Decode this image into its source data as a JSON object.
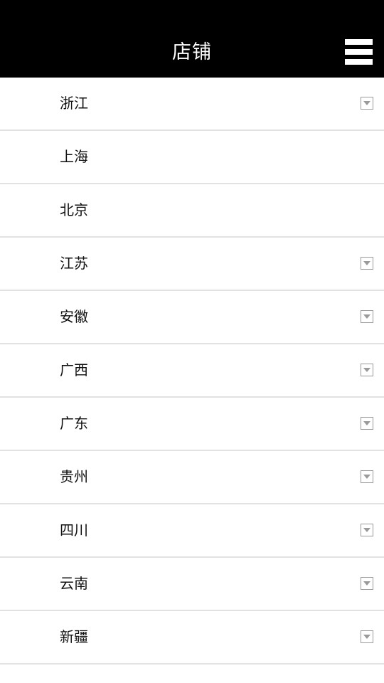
{
  "header": {
    "title": "店铺",
    "menu_icon": "hamburger-menu-icon",
    "background": "#000000",
    "text_color": "#ffffff"
  },
  "regions": [
    {
      "label": "浙江",
      "expandable": true
    },
    {
      "label": "上海",
      "expandable": false
    },
    {
      "label": "北京",
      "expandable": false
    },
    {
      "label": "江苏",
      "expandable": true
    },
    {
      "label": "安徽",
      "expandable": true
    },
    {
      "label": "广西",
      "expandable": true
    },
    {
      "label": "广东",
      "expandable": true
    },
    {
      "label": "贵州",
      "expandable": true
    },
    {
      "label": "四川",
      "expandable": true
    },
    {
      "label": "云南",
      "expandable": true
    },
    {
      "label": "新疆",
      "expandable": true
    }
  ],
  "icons": {
    "expand": "dropdown-arrow-icon"
  },
  "colors": {
    "divider": "#e2e2e2",
    "icon_border": "#9a9a9a"
  }
}
